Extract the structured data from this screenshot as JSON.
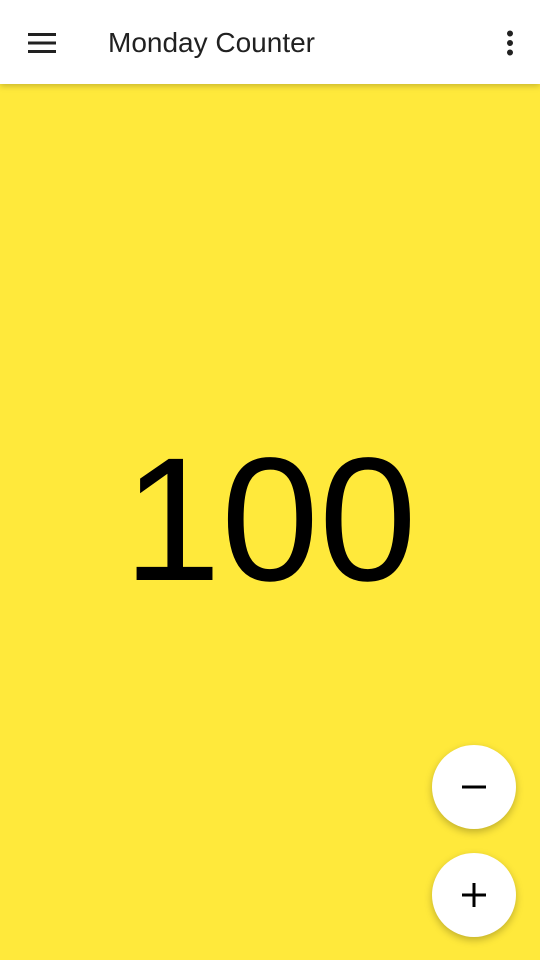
{
  "app": {
    "title": "Monday Counter",
    "background_color": "#ffe93b",
    "toolbar_color": "#ffffff"
  },
  "toolbar": {
    "menu_icon": "hamburger-menu-icon",
    "overflow_icon": "more-vert-icon"
  },
  "counter": {
    "value": "100"
  },
  "actions": {
    "decrement_icon": "minus-icon",
    "increment_icon": "plus-icon"
  }
}
